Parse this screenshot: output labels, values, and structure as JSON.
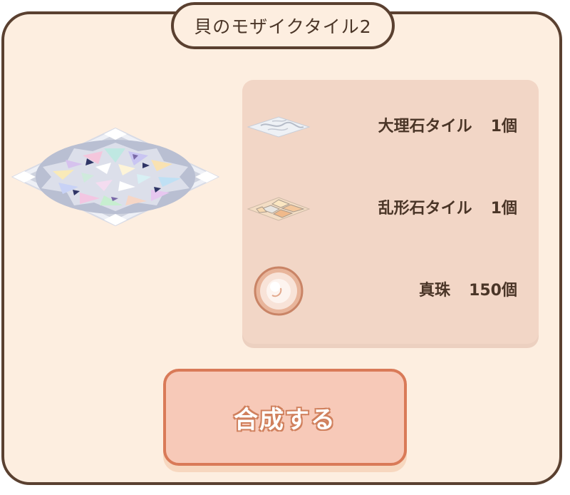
{
  "dialog": {
    "title": "貝のモザイクタイル2"
  },
  "product": {
    "icon": "shell-mosaic-tile-icon"
  },
  "materials": [
    {
      "name": "大理石タイル",
      "count": "1個",
      "icon": "marble-tile-icon"
    },
    {
      "name": "乱形石タイル",
      "count": "1個",
      "icon": "random-stone-tile-icon"
    },
    {
      "name": "真珠",
      "count": "150個",
      "icon": "pearl-icon"
    }
  ],
  "actions": {
    "synthesize_label": "合成する"
  },
  "colors": {
    "panel_bg": "#fdeee0",
    "panel_border": "#5a4030",
    "materials_bg": "#f2d6c6",
    "button_bg": "#f7c9b8",
    "button_border": "#d97a58"
  }
}
